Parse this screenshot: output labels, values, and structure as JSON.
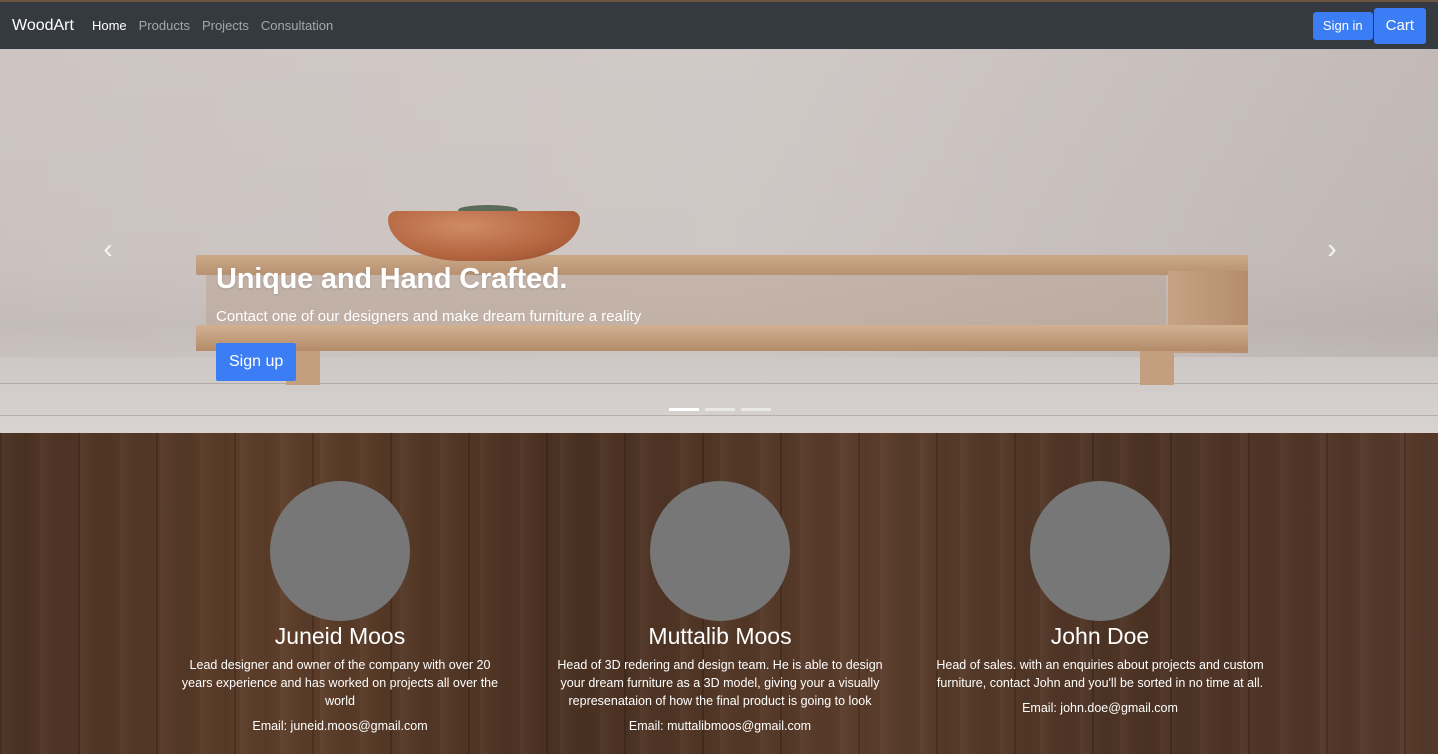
{
  "nav": {
    "brand": "WoodArt",
    "links": [
      "Home",
      "Products",
      "Projects",
      "Consultation"
    ],
    "signin_label": "Sign in",
    "cart_label": "Cart"
  },
  "hero": {
    "title": "Unique and Hand Crafted.",
    "subtitle": "Contact one of our designers and make dream furniture a reality",
    "button_label": "Sign up",
    "prev_icon": "‹",
    "next_icon": "›",
    "slide_count": 3,
    "active_slide": 1
  },
  "team": [
    {
      "name": "Juneid Moos",
      "bio": "Lead designer and owner of the company with over 20 years experience and has worked on projects all over the world",
      "email": "Email: juneid.moos@gmail.com"
    },
    {
      "name": "Muttalib Moos",
      "bio": "Head of 3D redering and design team. He is able to design your dream furniture as a 3D model, giving your a visually represenataion of how the final product is going to look",
      "email": "Email: muttalibmoos@gmail.com"
    },
    {
      "name": "John Doe",
      "bio": "Head of sales. with an enquiries about projects and custom furniture, contact John and you'll be sorted in no time at all.",
      "email": "Email: john.doe@gmail.com"
    }
  ],
  "colors": {
    "navbar": "#343a40",
    "primary": "#3b7df5",
    "avatar": "#777777"
  }
}
